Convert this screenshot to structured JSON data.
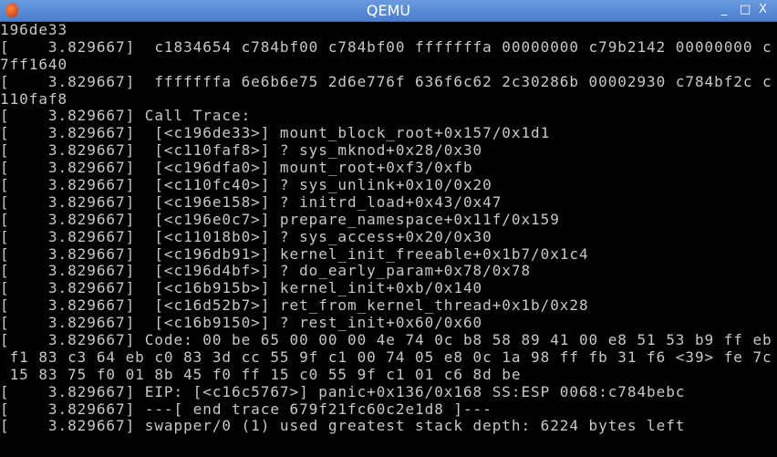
{
  "window": {
    "title": "QEMU",
    "minimize": "_",
    "maximize": "□",
    "close": "X"
  },
  "console": {
    "lines": [
      "196de33",
      "[    3.829667]  c1834654 c784bf00 c784bf00 fffffffa 00000000 c79b2142 00000000 c",
      "7ff1640",
      "[    3.829667]  fffffffa 6e6b6e75 2d6e776f 636f6c62 2c30286b 00002930 c784bf2c c",
      "110faf8",
      "[    3.829667] Call Trace:",
      "[    3.829667]  [<c196de33>] mount_block_root+0x157/0x1d1",
      "[    3.829667]  [<c110faf8>] ? sys_mknod+0x28/0x30",
      "[    3.829667]  [<c196dfa0>] mount_root+0xf3/0xfb",
      "[    3.829667]  [<c110fc40>] ? sys_unlink+0x10/0x20",
      "[    3.829667]  [<c196e158>] ? initrd_load+0x43/0x47",
      "[    3.829667]  [<c196e0c7>] prepare_namespace+0x11f/0x159",
      "[    3.829667]  [<c11018b0>] ? sys_access+0x20/0x30",
      "[    3.829667]  [<c196db91>] kernel_init_freeable+0x1b7/0x1c4",
      "[    3.829667]  [<c196d4bf>] ? do_early_param+0x78/0x78",
      "[    3.829667]  [<c16b915b>] kernel_init+0xb/0x140",
      "[    3.829667]  [<c16d52b7>] ret_from_kernel_thread+0x1b/0x28",
      "[    3.829667]  [<c16b9150>] ? rest_init+0x60/0x60",
      "[    3.829667] Code: 00 be 65 00 00 00 4e 74 0c b8 58 89 41 00 e8 51 53 b9 ff eb",
      " f1 83 c3 64 eb c0 83 3d cc 55 9f c1 00 74 05 e8 0c 1a 98 ff fb 31 f6 <39> fe 7c",
      " 15 83 75 f0 01 8b 45 f0 ff 15 c0 55 9f c1 01 c6 8d be",
      "[    3.829667] EIP: [<c16c5767>] panic+0x136/0x168 SS:ESP 0068:c784bebc",
      "[    3.829667] ---[ end trace 679f21fc60c2e1d8 ]---",
      "[    3.829667] swapper/0 (1) used greatest stack depth: 6224 bytes left"
    ]
  }
}
